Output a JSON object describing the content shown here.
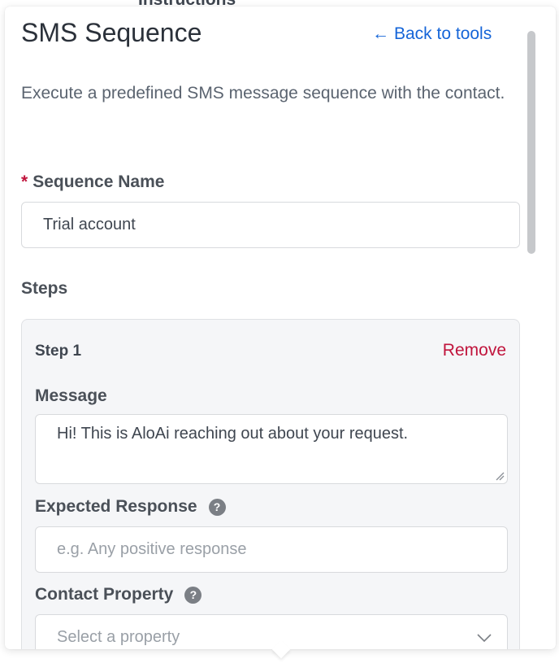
{
  "backdrop": {
    "text": "Instructions"
  },
  "header": {
    "title": "SMS Sequence",
    "back_arrow": "←",
    "back_label": "Back to tools"
  },
  "description": "Execute a predefined SMS message sequence with the contact.",
  "sequence": {
    "required_mark": "*",
    "label": "Sequence Name",
    "value": "Trial account"
  },
  "steps": {
    "label": "Steps",
    "items": [
      {
        "title": "Step 1",
        "remove_label": "Remove",
        "message_label": "Message",
        "message_value": "Hi! This is AloAi reaching out about your request.",
        "expected_label": "Expected Response",
        "expected_placeholder": "e.g. Any positive response",
        "property_label": "Contact Property",
        "property_placeholder": "Select a property"
      }
    ]
  },
  "colors": {
    "accent": "#1565d8",
    "danger": "#c0143c"
  },
  "icons": {
    "help": "?"
  }
}
